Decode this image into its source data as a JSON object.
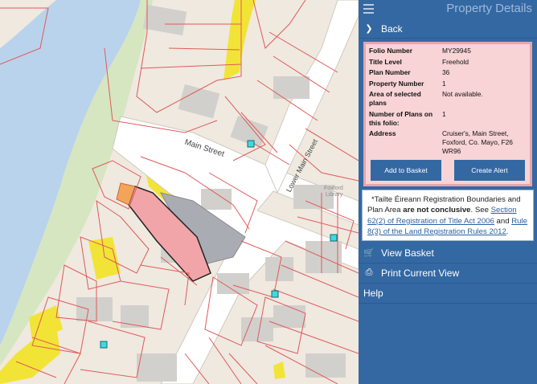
{
  "panel": {
    "title": "Property Details",
    "back_label": "Back",
    "details": [
      {
        "label": "Folio Number",
        "value": "MY29945"
      },
      {
        "label": "Title Level",
        "value": "Freehold"
      },
      {
        "label": "Plan Number",
        "value": "36"
      },
      {
        "label": "Property Number",
        "value": "1"
      },
      {
        "label": "Area of selected plans",
        "value": "Not available."
      },
      {
        "label": "Number of Plans on this folio:",
        "value": "1"
      },
      {
        "label": "Address",
        "value": "Cruiser's, Main Street, Foxford, Co. Mayo, F26 WR96"
      }
    ],
    "add_to_basket": "Add to Basket",
    "create_alert": "Create Alert",
    "disclaimer": {
      "prefix": "*Tailte Éireann Registration Boundaries and Plan Area ",
      "bold": "are not conclusive",
      "mid": ". See ",
      "link1": "Section 62(2) of Registration of Title Act 2006",
      "and": " and ",
      "link2": "Rule 8(3) of the Land Registration Rules 2012",
      "end": "."
    },
    "view_basket": "View Basket",
    "print_view": "Print Current View",
    "help": "Help"
  },
  "map": {
    "street_main": "Main Street",
    "street_lower": "Lower Main Street",
    "label_library_1": "Foxford",
    "label_library_2": "Library"
  },
  "colors": {
    "panel_bg": "#3468a3",
    "river": "#b9d3ec",
    "selected_parcel": "#f2a5a8",
    "plot_outline": "#e05a5a"
  }
}
